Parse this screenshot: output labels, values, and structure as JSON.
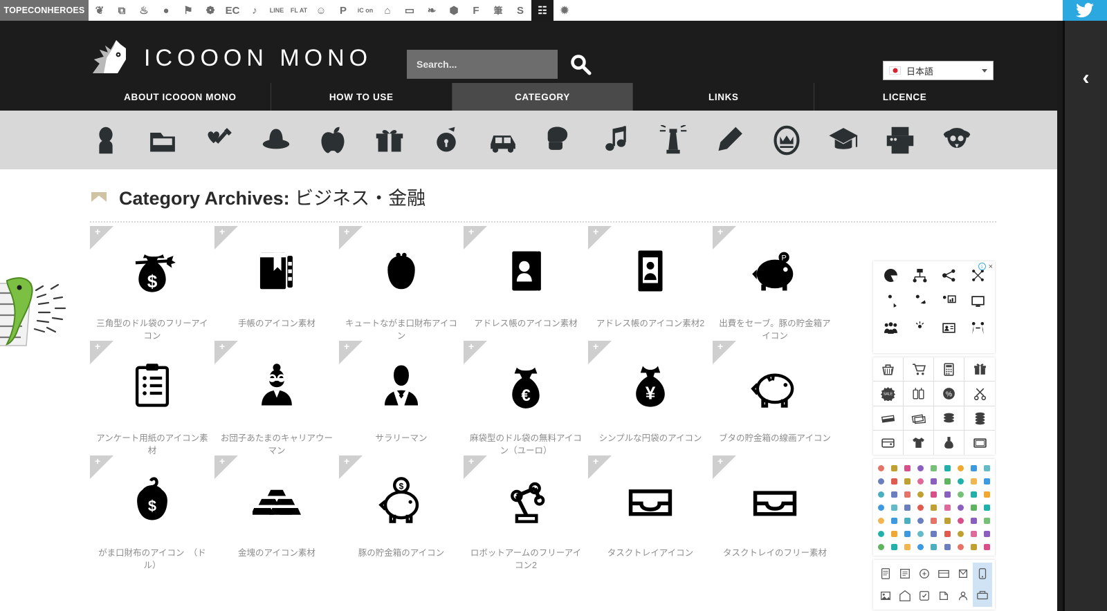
{
  "topbar": {
    "brand": "TOPECONHEROES",
    "icons": [
      {
        "name": "sheep-icon",
        "glyph": "❦"
      },
      {
        "name": "copy-icon",
        "glyph": "⧉"
      },
      {
        "name": "cutlery-icon",
        "glyph": "♨"
      },
      {
        "name": "speech-bubble-icon",
        "glyph": "●"
      },
      {
        "name": "flag-icon",
        "glyph": "⚑"
      },
      {
        "name": "flower-icon",
        "glyph": "❁"
      },
      {
        "name": "ec-icon",
        "glyph": "EC"
      },
      {
        "name": "music-note-icon",
        "glyph": "♪"
      },
      {
        "name": "line-icon",
        "glyph": "LINE"
      },
      {
        "name": "flat-icon",
        "glyph": "FL AT"
      },
      {
        "name": "smiley-icon",
        "glyph": "☺"
      },
      {
        "name": "parking-icon",
        "glyph": "P"
      },
      {
        "name": "icon-icon",
        "glyph": "iC on"
      },
      {
        "name": "building-icon",
        "glyph": "⌂"
      },
      {
        "name": "sofa-icon",
        "glyph": "▭"
      },
      {
        "name": "bird-icon",
        "glyph": "❧"
      },
      {
        "name": "gem-icon",
        "glyph": "⬢"
      },
      {
        "name": "f-icon",
        "glyph": "F"
      },
      {
        "name": "brush-icon",
        "glyph": "筆"
      },
      {
        "name": "s-plus-icon",
        "glyph": "S"
      },
      {
        "name": "grid-icon",
        "glyph": "☷",
        "selected": true
      },
      {
        "name": "sparkle-icon",
        "glyph": "✹"
      }
    ],
    "twitter_label": "twitter-icon"
  },
  "header": {
    "logo_text": "ICOOON MONO",
    "logo_mark_name": "unicorn-head-logo",
    "search_placeholder": "Search...",
    "search_value": "",
    "search_button_label": "search-icon",
    "language": "日本語"
  },
  "nav": {
    "items": [
      {
        "label": "ABOUT ICOOON MONO",
        "active": false
      },
      {
        "label": "HOW TO USE",
        "active": false
      },
      {
        "label": "CATEGORY",
        "active": true
      },
      {
        "label": "LINKS",
        "active": false
      },
      {
        "label": "LICENCE",
        "active": false
      }
    ]
  },
  "category_strip": {
    "icons": [
      {
        "name": "person-icon"
      },
      {
        "name": "folder-icon"
      },
      {
        "name": "heart-syringe-icon"
      },
      {
        "name": "hat-icon"
      },
      {
        "name": "apple-icon"
      },
      {
        "name": "gift-icon"
      },
      {
        "name": "piggy-bank-icon"
      },
      {
        "name": "car-icon"
      },
      {
        "name": "boxing-glove-icon"
      },
      {
        "name": "music-note-icon"
      },
      {
        "name": "lighthouse-icon"
      },
      {
        "name": "pencil-icon"
      },
      {
        "name": "crown-badge-icon"
      },
      {
        "name": "graduation-cap-icon"
      },
      {
        "name": "printer-icon"
      },
      {
        "name": "pirate-skull-icon"
      }
    ]
  },
  "main": {
    "title_prefix": "Category Archives:",
    "title_category": "ビジネス・金融",
    "bookmark_icon_name": "bookmark-ribbon-icon",
    "corner_plus": "+",
    "items": [
      {
        "label": "三角型のドル袋のフリーアイコン",
        "icon": "money-bag-dollar-icon"
      },
      {
        "label": "手帳のアイコン素材",
        "icon": "notebook-icon"
      },
      {
        "label": "キュートながま口財布アイコン",
        "icon": "coin-purse-icon"
      },
      {
        "label": "アドレス帳のアイコン素材",
        "icon": "address-book-icon"
      },
      {
        "label": "アドレス帳のアイコン素材2",
        "icon": "address-book-2-icon"
      },
      {
        "label": "出費をセーブ。豚の貯金箱アイコン",
        "icon": "piggy-bank-save-icon"
      },
      {
        "label": "アンケート用紙のアイコン素材",
        "icon": "clipboard-survey-icon"
      },
      {
        "label": "お団子あたまのキャリアウーマン",
        "icon": "career-woman-icon"
      },
      {
        "label": "サラリーマン",
        "icon": "businessman-icon"
      },
      {
        "label": "麻袋型のドル袋の無料アイコン（ユーロ）",
        "icon": "euro-bag-icon"
      },
      {
        "label": "シンプルな円袋のアイコン",
        "icon": "yen-bag-icon"
      },
      {
        "label": "ブタの貯金箱の線画アイコン",
        "icon": "piggy-bank-outline-icon"
      },
      {
        "label": "がま口財布のアイコン　（ドル）",
        "icon": "coin-purse-dollar-icon"
      },
      {
        "label": "金塊のアイコン素材",
        "icon": "gold-bars-icon"
      },
      {
        "label": "豚の貯金箱のアイコン",
        "icon": "piggy-bank-coin-icon"
      },
      {
        "label": "ロボットアームのフリーアイコン2",
        "icon": "robot-arm-icon"
      },
      {
        "label": "タスクトレイアイコン",
        "icon": "task-tray-icon"
      },
      {
        "label": "タスクトレイのフリー素材",
        "icon": "task-tray-free-icon"
      }
    ]
  },
  "ads": {
    "info_badge": "i",
    "close_badge": "×",
    "block1_icons": [
      "pie-chart-icon",
      "org-chart-icon",
      "share-nodes-icon",
      "network-icon",
      "presenter-down-icon",
      "presenter-up-icon",
      "presenter-chart-icon",
      "monitor-icon",
      "team-icon",
      "idea-person-icon",
      "id-card-icon",
      "handshake-people-icon"
    ],
    "block2_icons": [
      "shopping-basket-icon",
      "shopping-cart-icon",
      "calculator-icon",
      "gift-box-icon",
      "sale-badge-icon",
      "price-tags-icon",
      "percent-circle-icon",
      "scissors-icon",
      "cash-stack-icon",
      "banknotes-icon",
      "coin-stack-icon",
      "coin-stack-2-icon",
      "wallet-icon",
      "t-shirt-icon",
      "perfume-icon",
      "tv-icon"
    ]
  },
  "rail": {
    "collapse_icon": "‹"
  },
  "mascot": {
    "name": "green-frog-mascot"
  }
}
